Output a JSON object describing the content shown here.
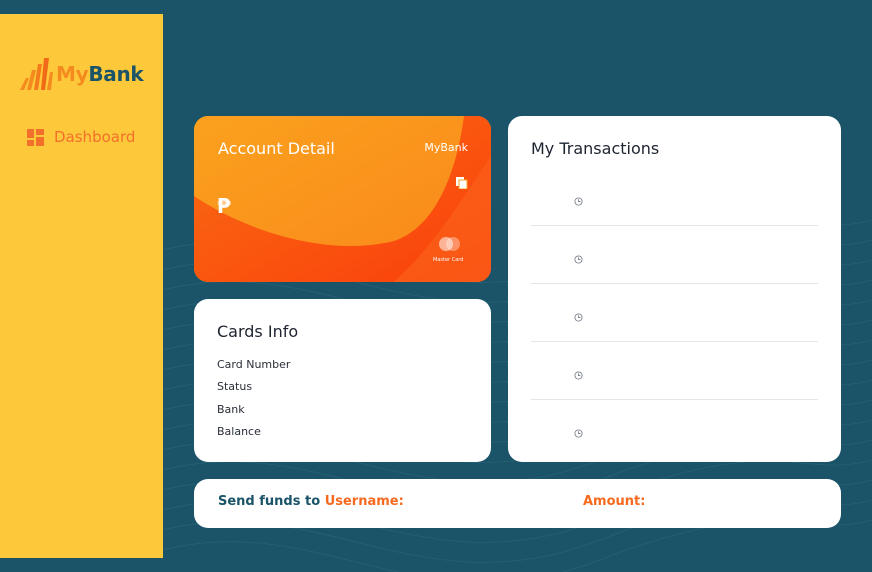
{
  "app": {
    "logo_my": "My",
    "logo_bank": "Bank"
  },
  "sidebar": {
    "items": [
      {
        "label": "Dashboard",
        "icon": "dashboard-grid-icon"
      }
    ]
  },
  "account_card": {
    "title": "Account Detail",
    "brand": "MyBank",
    "currency_symbol": "₱",
    "network_label": "Master Card",
    "copy_icon": "copy-icon",
    "network_icon": "mastercard-logo-icon"
  },
  "cards_info": {
    "title": "Cards Info",
    "fields": [
      "Card Number",
      "Status",
      "Bank",
      "Balance"
    ]
  },
  "transactions": {
    "title": "My Transactions",
    "row_icon": "clock-icon",
    "rows": 5
  },
  "send_funds": {
    "prefix": "Send funds to ",
    "username_label": "Username:",
    "amount_label": "Amount:"
  },
  "colors": {
    "background": "#1b5468",
    "sidebar": "#fdc93a",
    "accent_orange": "#f56a1f",
    "brand_dark": "#1b5468"
  }
}
